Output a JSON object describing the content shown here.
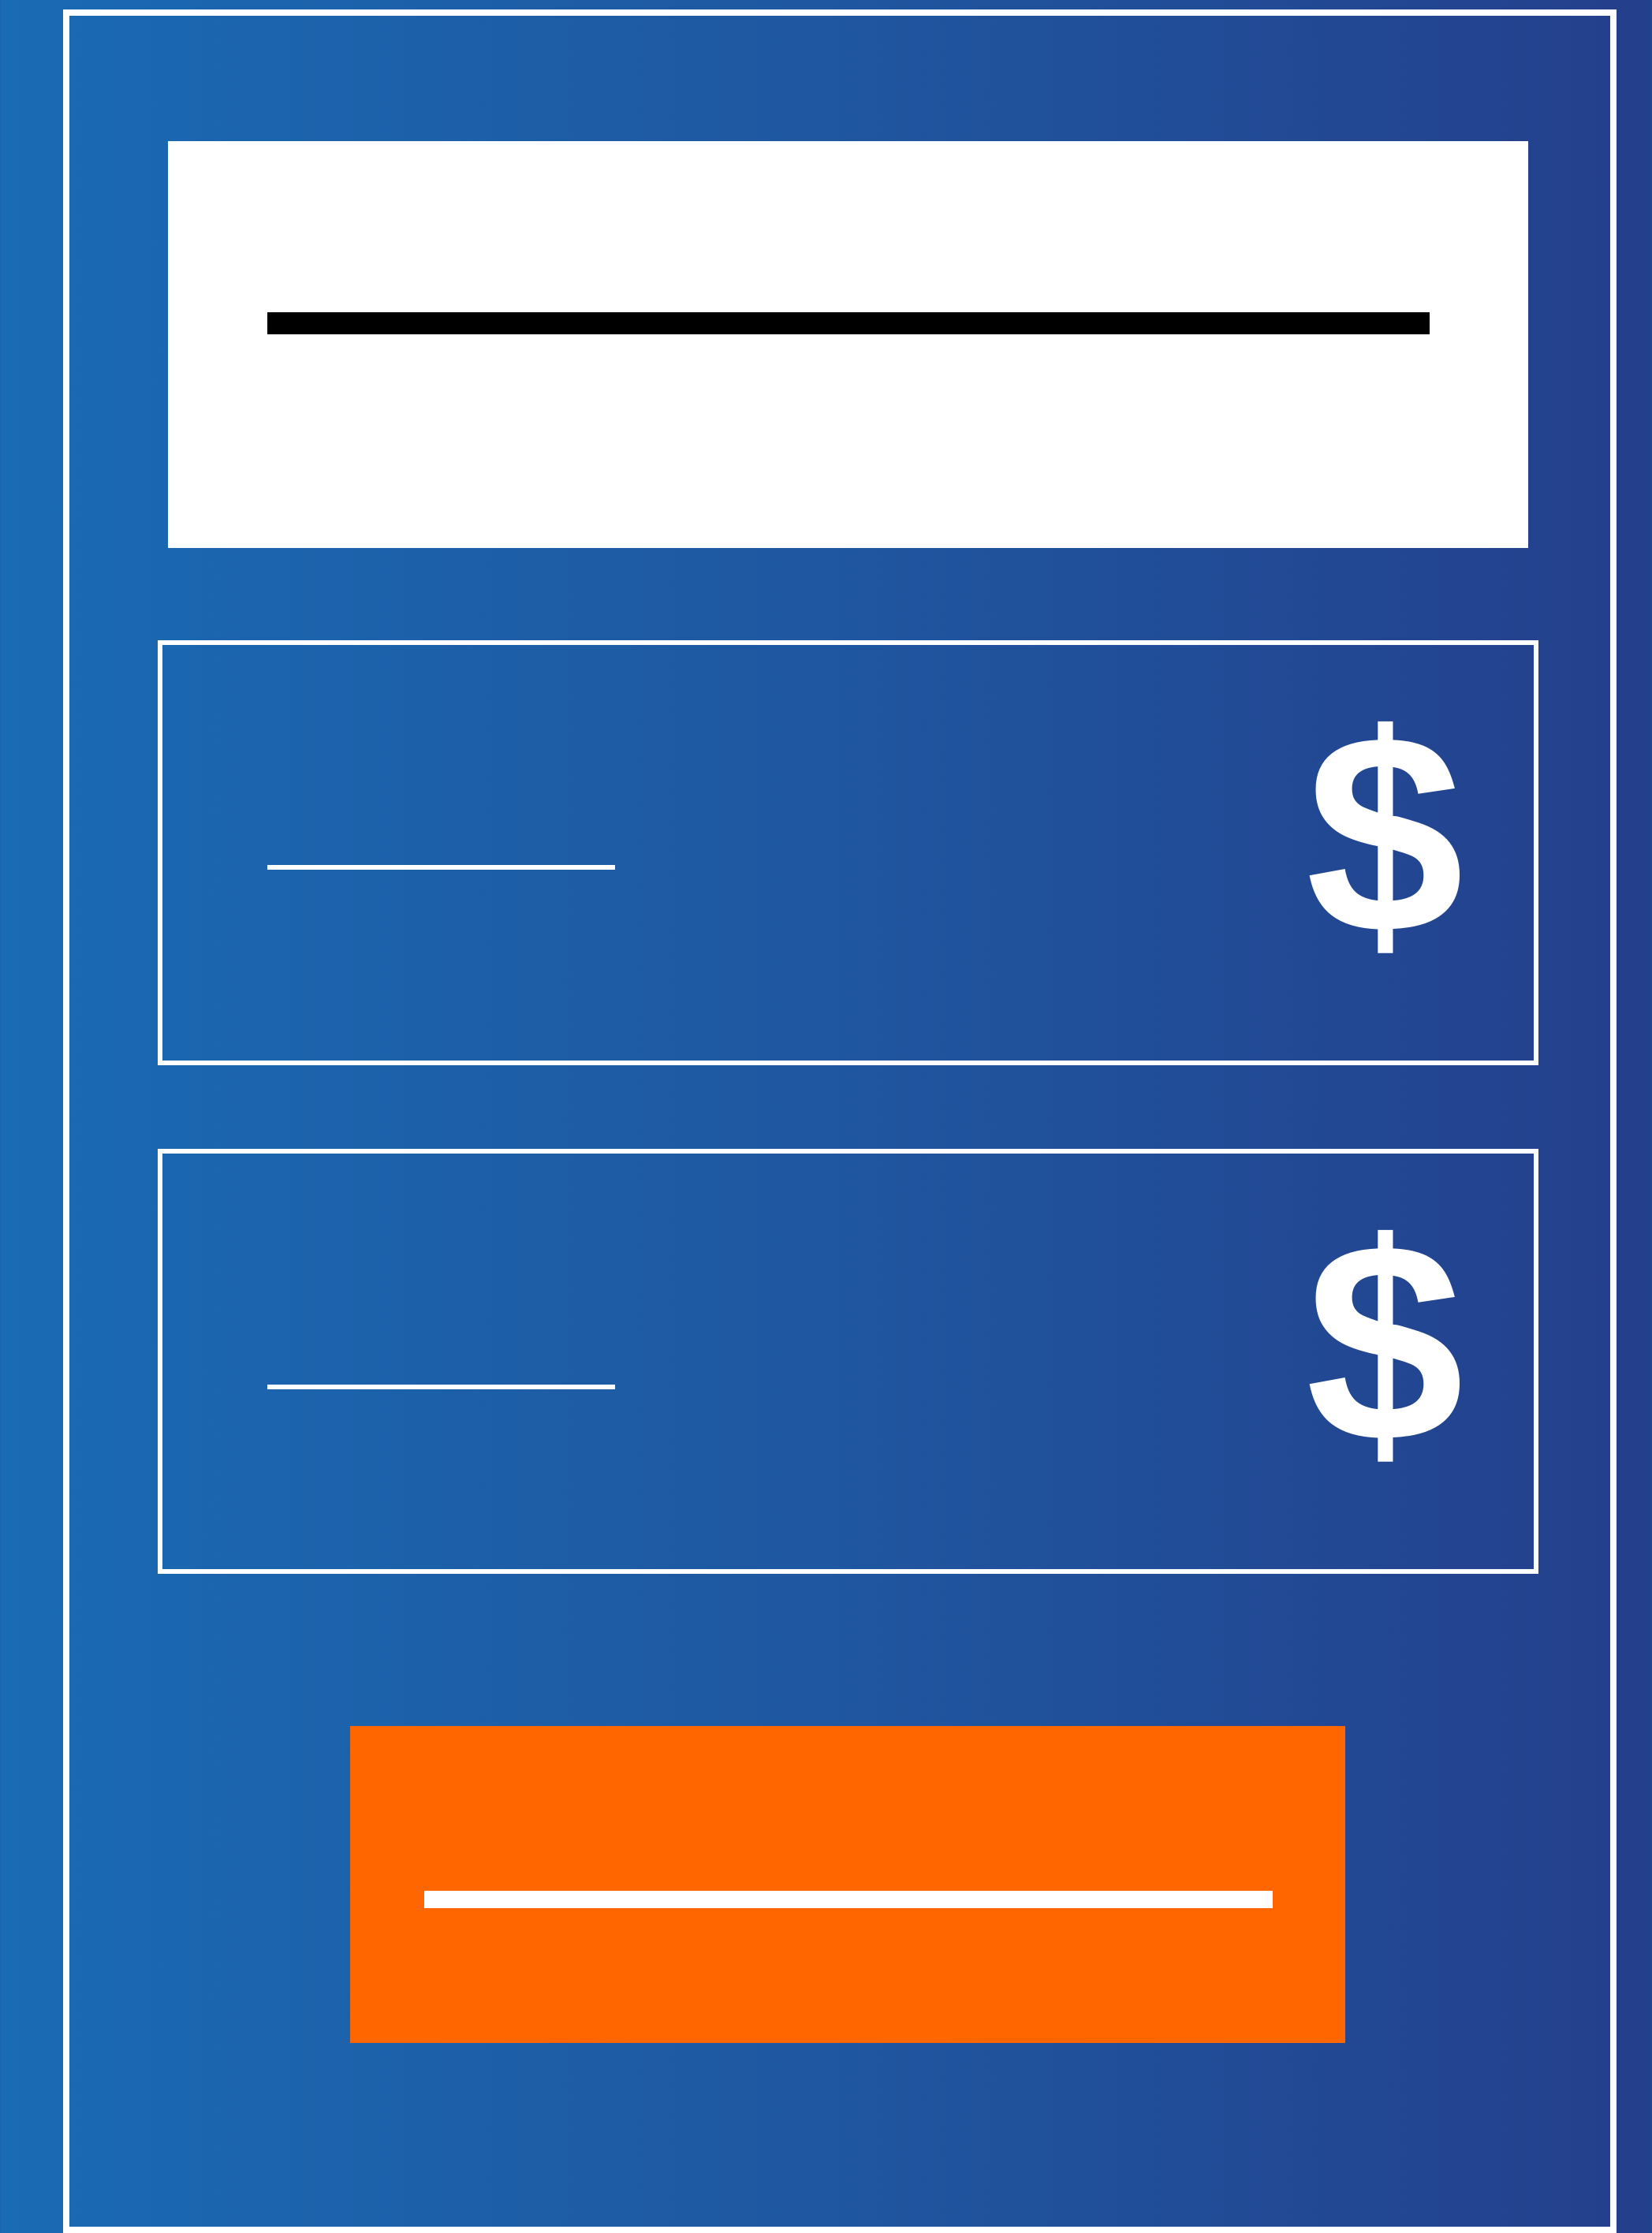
{
  "fields": [
    {
      "currency_symbol": "$"
    },
    {
      "currency_symbol": "$"
    }
  ],
  "colors": {
    "background_start": "#1a6ab4",
    "background_end": "#243f8c",
    "accent": "#ff6600",
    "header_background": "#ffffff",
    "border": "#ffffff"
  }
}
